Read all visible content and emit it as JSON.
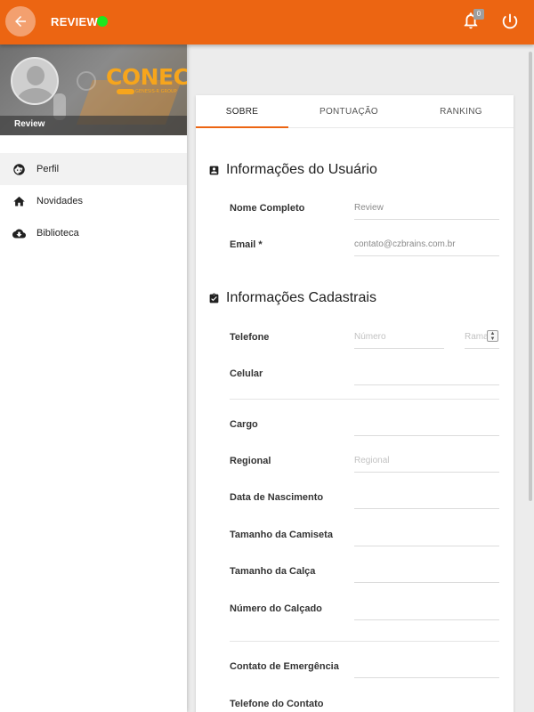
{
  "header": {
    "title": "REVIEW",
    "status_color": "#1ee61e",
    "notification_count": "0",
    "accent": "#ec6512"
  },
  "sidebar": {
    "profile_name": "Review",
    "brand": {
      "logo": "CONECTA",
      "tagline": "GENESIS-R GROUP"
    },
    "items": [
      {
        "label": "Perfil",
        "icon": "face-icon",
        "active": true
      },
      {
        "label": "Novidades",
        "icon": "home-icon",
        "active": false
      },
      {
        "label": "Biblioteca",
        "icon": "cloud-download-icon",
        "active": false
      }
    ]
  },
  "tabs": [
    {
      "label": "SOBRE",
      "active": true
    },
    {
      "label": "PONTUAÇÃO",
      "active": false
    },
    {
      "label": "RANKING",
      "active": false
    }
  ],
  "user_info": {
    "title": "Informações do Usuário",
    "full_name_label": "Nome Completo",
    "full_name_value": "Review",
    "email_label": "Email *",
    "email_value": "contato@czbrains.com.br"
  },
  "registration_info": {
    "title": "Informações Cadastrais",
    "phone_label": "Telefone",
    "phone_placeholder": "Número",
    "extension_placeholder": "Ramal",
    "mobile_label": "Celular",
    "position_label": "Cargo",
    "regional_label": "Regional",
    "regional_placeholder": "Regional",
    "birthdate_label": "Data de Nascimento",
    "shirt_size_label": "Tamanho da Camiseta",
    "pants_size_label": "Tamanho da Calça",
    "shoe_size_label": "Número do Calçado",
    "emergency_contact_label": "Contato de Emergência",
    "contact_phone_label": "Telefone do Contato"
  }
}
